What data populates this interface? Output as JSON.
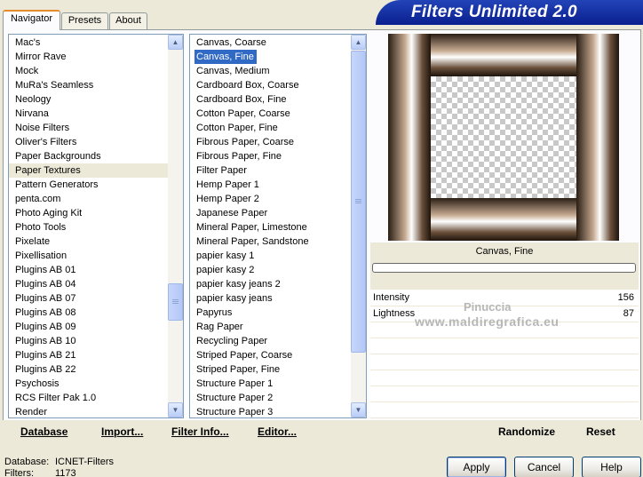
{
  "tabs": [
    "Navigator",
    "Presets",
    "About"
  ],
  "title": "Filters Unlimited 2.0",
  "categories": {
    "items": [
      "Mac's",
      "Mirror Rave",
      "Mock",
      "MuRa's Seamless",
      "Neology",
      "Nirvana",
      "Noise Filters",
      "Oliver's Filters",
      "Paper Backgrounds",
      "Paper Textures",
      "Pattern Generators",
      "penta.com",
      "Photo Aging Kit",
      "Photo Tools",
      "Pixelate",
      "Pixellisation",
      "Plugins AB 01",
      "Plugins AB 04",
      "Plugins AB 07",
      "Plugins AB 08",
      "Plugins AB 09",
      "Plugins AB 10",
      "Plugins AB 21",
      "Plugins AB 22",
      "Psychosis",
      "RCS Filter Pak 1.0",
      "Render"
    ],
    "highlighted": "Paper Textures"
  },
  "filters": {
    "items": [
      "Canvas, Coarse",
      "Canvas, Fine",
      "Canvas, Medium",
      "Cardboard Box, Coarse",
      "Cardboard Box, Fine",
      "Cotton Paper, Coarse",
      "Cotton Paper, Fine",
      "Fibrous Paper, Coarse",
      "Fibrous Paper, Fine",
      "Filter Paper",
      "Hemp Paper 1",
      "Hemp Paper 2",
      "Japanese Paper",
      "Mineral Paper, Limestone",
      "Mineral Paper, Sandstone",
      "papier kasy 1",
      "papier kasy 2",
      "papier kasy jeans 2",
      "papier kasy jeans",
      "Papyrus",
      "Rag Paper",
      "Recycling Paper",
      "Striped Paper, Coarse",
      "Striped Paper, Fine",
      "Structure Paper 1",
      "Structure Paper 2",
      "Structure Paper 3"
    ],
    "selected": "Canvas, Fine"
  },
  "preview": {
    "filter_name": "Canvas, Fine"
  },
  "params": [
    {
      "label": "Intensity",
      "value": "156"
    },
    {
      "label": "Lightness",
      "value": "87"
    }
  ],
  "watermark": {
    "line1": "Pinuccia",
    "line2": "www.maldiregrafica.eu"
  },
  "toolbar": {
    "database": "Database",
    "import": "Import...",
    "filter_info": "Filter Info...",
    "editor": "Editor...",
    "randomize": "Randomize",
    "reset": "Reset"
  },
  "status": {
    "database_label": "Database:",
    "database_value": "ICNET-Filters",
    "filters_label": "Filters:",
    "filters_value": "1173"
  },
  "buttons": {
    "apply": "Apply",
    "cancel": "Cancel",
    "help": "Help"
  },
  "colors": {
    "selection": "#316ac5",
    "title_bar": "#0a1f8f",
    "frame_brown": "#6a4f3a"
  }
}
